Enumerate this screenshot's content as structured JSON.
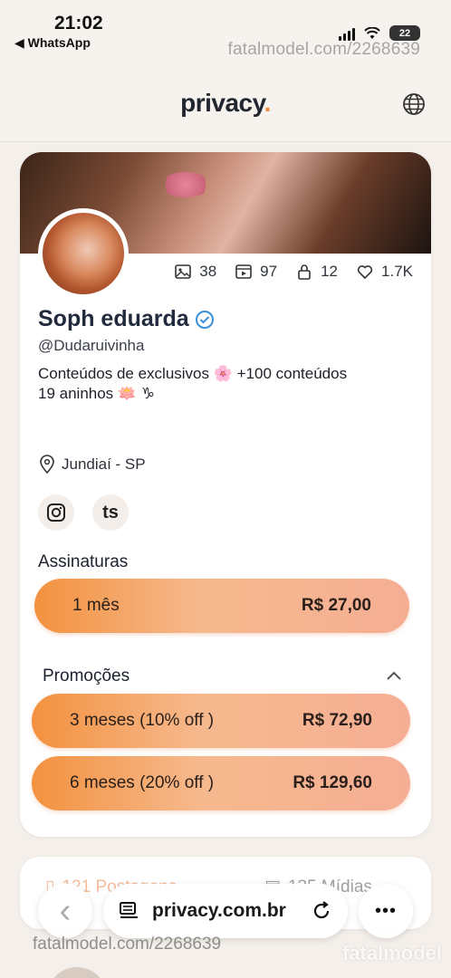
{
  "status_bar": {
    "time": "21:02",
    "back_app": "◀ WhatsApp",
    "battery": "22"
  },
  "watermark": {
    "top": "fatalmodel.com/2268639",
    "bottom": "fatalmodel.com/2268639",
    "brand": "fatalmodel"
  },
  "header": {
    "logo": "privacy",
    "logo_dot": "."
  },
  "profile": {
    "stats": {
      "images": "38",
      "videos": "97",
      "locked": "12",
      "likes": "1.7K"
    },
    "name": "Soph eduarda",
    "handle": "@Dudaruivinha",
    "bio_line1": "Conteúdos de exclusivos 🌸 +100 conteúdos",
    "bio_line2": "19 aninhos 🪷 ♑",
    "location": "Jundiaí - SP",
    "social_tiktok": "ts"
  },
  "subscriptions": {
    "title": "Assinaturas",
    "plans": [
      {
        "label": "1 mês",
        "price": "R$ 27,00"
      }
    ]
  },
  "promotions": {
    "title": "Promoções",
    "plans": [
      {
        "label": "3 meses (10% off )",
        "price": "R$ 72,90"
      },
      {
        "label": "6 meses (20% off )",
        "price": "R$ 129,60"
      }
    ]
  },
  "tabs": {
    "posts": "121 Postagens",
    "media": "135 Mídias"
  },
  "browser": {
    "url": "privacy.com.br",
    "back": "‹",
    "more": "•••"
  },
  "colors": {
    "accent": "#f28a3d",
    "plan_start": "#f3923f",
    "plan_end": "#f5ae94"
  }
}
